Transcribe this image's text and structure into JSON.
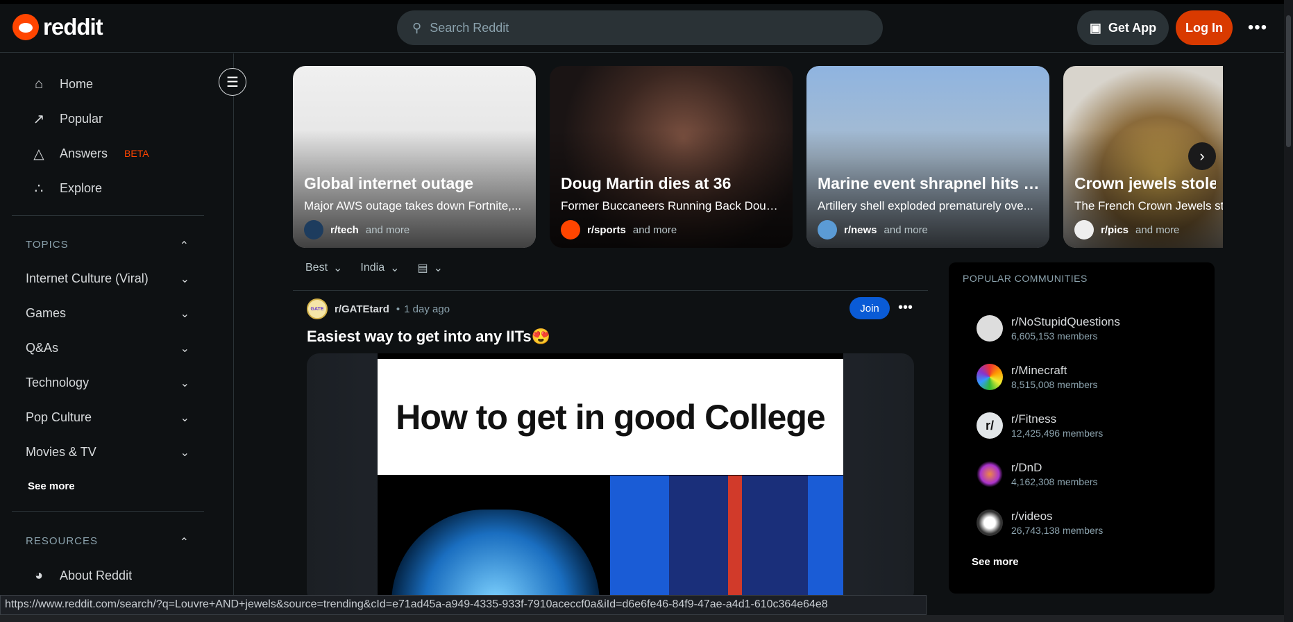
{
  "header": {
    "logo_text": "reddit",
    "search_placeholder": "Search Reddit",
    "get_app": "Get App",
    "login": "Log In"
  },
  "sidebar": {
    "nav": [
      {
        "label": "Home"
      },
      {
        "label": "Popular"
      },
      {
        "label": "Answers",
        "badge": "BETA"
      },
      {
        "label": "Explore"
      }
    ],
    "topics_label": "TOPICS",
    "topics": [
      "Internet Culture (Viral)",
      "Games",
      "Q&As",
      "Technology",
      "Pop Culture",
      "Movies & TV"
    ],
    "see_more": "See more",
    "resources_label": "RESOURCES",
    "resources": [
      "About Reddit"
    ]
  },
  "carousel": [
    {
      "title": "Global internet outage",
      "subtitle": "Major AWS outage takes down Fortnite,...",
      "community": "r/tech",
      "more": "and more"
    },
    {
      "title": "Doug Martin dies at 36",
      "subtitle": "Former Buccaneers Running Back Doug...",
      "community": "r/sports",
      "more": "and more"
    },
    {
      "title": "Marine event shrapnel hits c...",
      "subtitle": "Artillery shell exploded prematurely ove...",
      "community": "r/news",
      "more": "and more"
    },
    {
      "title": "Crown jewels stolen",
      "subtitle": "The French Crown Jewels stolen",
      "community": "r/pics",
      "more": "and more"
    }
  ],
  "sort": {
    "sort": "Best",
    "region": "India"
  },
  "post": {
    "community": "r/GATEtard",
    "time": "1 day ago",
    "join": "Join",
    "title": "Easiest way to get into any IITs😍",
    "image_text": "How to get in good College",
    "avatar_text": "GATE"
  },
  "popular": {
    "heading": "POPULAR COMMUNITIES",
    "communities": [
      {
        "name": "r/NoStupidQuestions",
        "members": "6,605,153 members"
      },
      {
        "name": "r/Minecraft",
        "members": "8,515,008 members"
      },
      {
        "name": "r/Fitness",
        "members": "12,425,496 members"
      },
      {
        "name": "r/DnD",
        "members": "4,162,308 members"
      },
      {
        "name": "r/videos",
        "members": "26,743,138 members"
      }
    ],
    "see_more": "See more"
  },
  "status_url": "https://www.reddit.com/search/?q=Louvre+AND+jewels&source=trending&cId=e71ad45a-a949-4335-933f-7910aceccf0a&iId=d6e6fe46-84f9-47ae-a4d1-610c364e64e8"
}
